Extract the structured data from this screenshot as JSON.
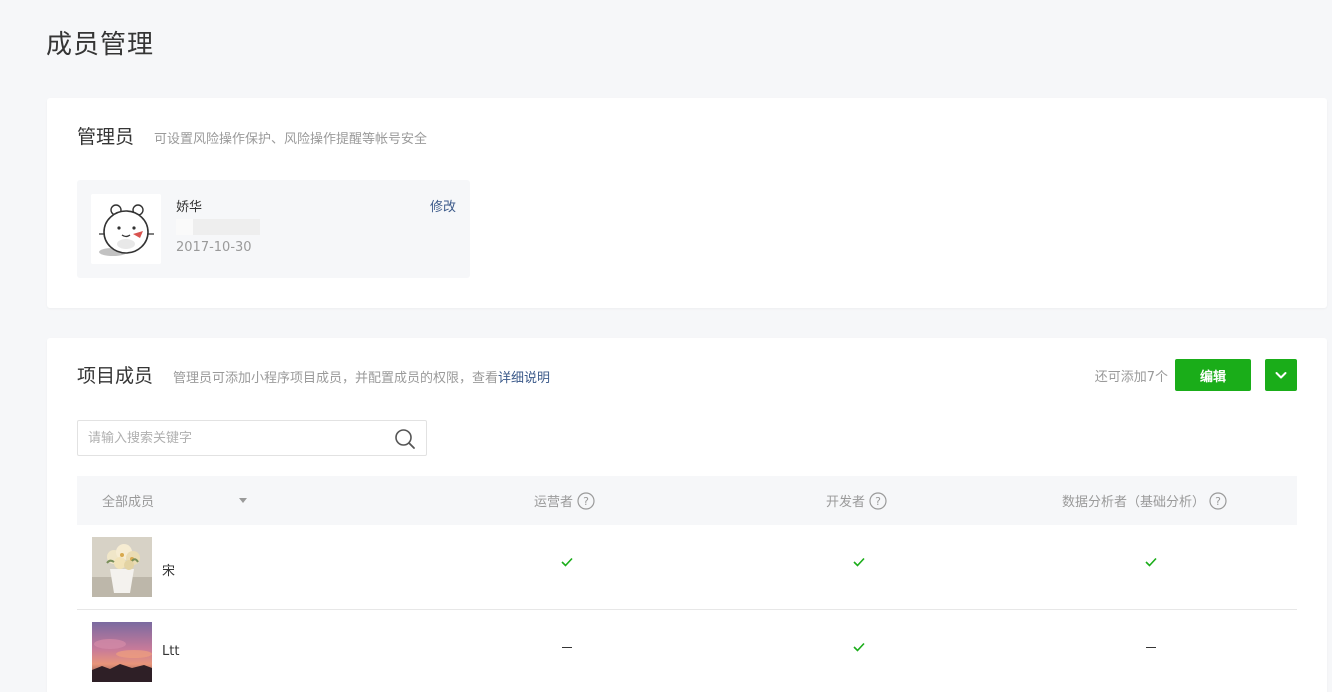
{
  "page": {
    "title": "成员管理"
  },
  "admin_section": {
    "title": "管理员",
    "description": "可设置风险操作保护、风险操作提醒等帐号安全",
    "admin": {
      "name": "娇华",
      "date": "2017-10-30",
      "edit_label": "修改",
      "avatar_icon": "bear-avatar-icon"
    }
  },
  "members_section": {
    "title": "项目成员",
    "description": "管理员可添加小程序项目成员，并配置成员的权限，查看",
    "detail_link": "详细说明",
    "remaining": "还可添加7个",
    "edit_button": "编辑",
    "search": {
      "placeholder": "请输入搜索关键字",
      "value": ""
    },
    "columns": [
      {
        "label": "全部成员",
        "help": false
      },
      {
        "label": "运营者",
        "help": true
      },
      {
        "label": "开发者",
        "help": true
      },
      {
        "label": "数据分析者（基础分析）",
        "help": true
      }
    ],
    "rows": [
      {
        "name": "宋",
        "avatar": "flower-pot-photo",
        "operator": true,
        "developer": true,
        "analyst": true
      },
      {
        "name": "Ltt",
        "avatar": "sunset-photo",
        "operator": false,
        "developer": true,
        "analyst": false
      }
    ]
  },
  "colors": {
    "primary_green": "#1aad19",
    "link_blue": "#3c5a8a",
    "background": "#f6f7f9"
  }
}
